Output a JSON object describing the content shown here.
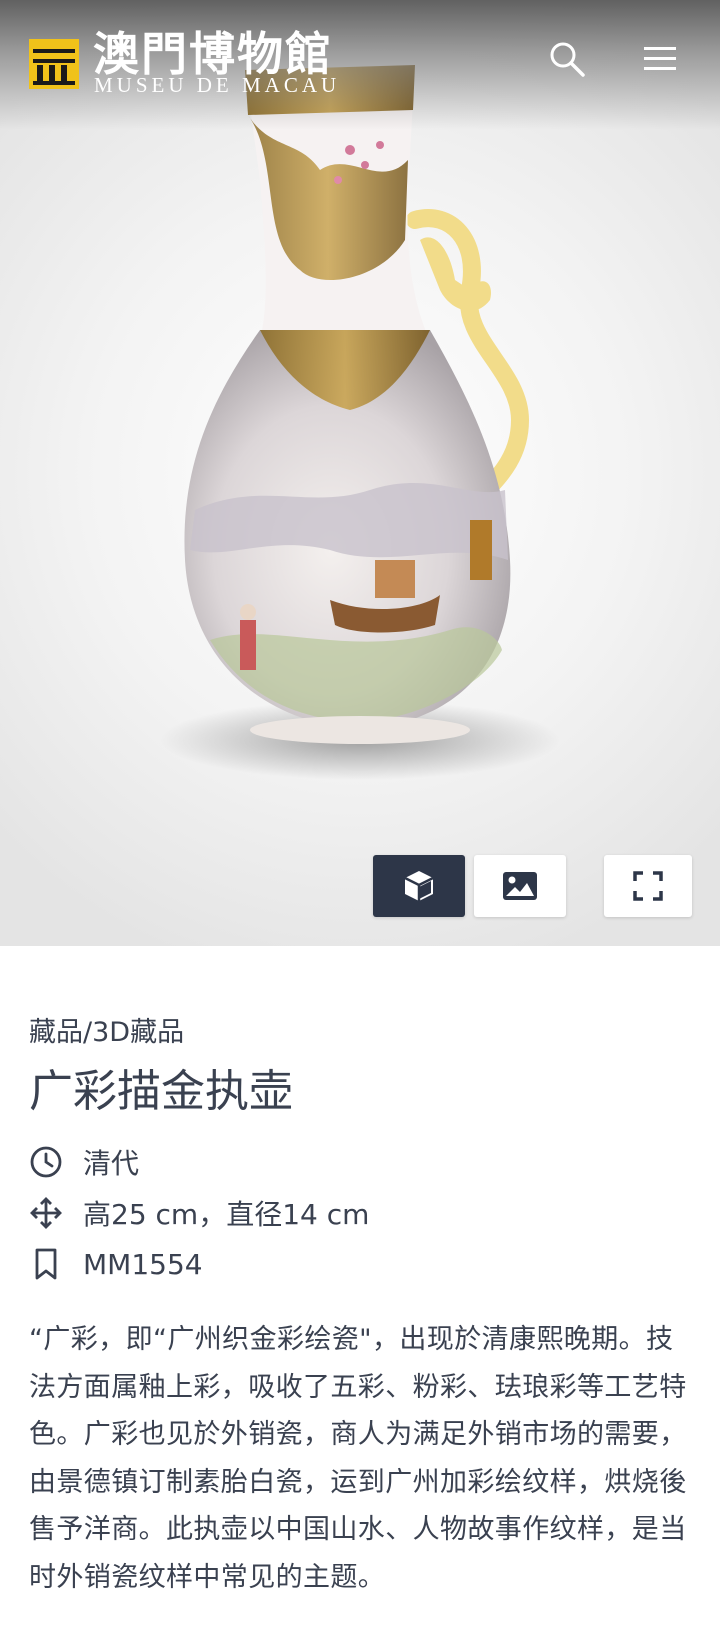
{
  "header": {
    "logo_title": "澳門博物館",
    "logo_subtitle": "MUSEU DE MACAU",
    "search_icon": "search-icon",
    "menu_icon": "menu-icon"
  },
  "viewer": {
    "controls": [
      {
        "icon": "cube-icon",
        "active": true
      },
      {
        "icon": "image-icon",
        "active": false
      },
      {
        "icon": "fullscreen-icon",
        "active": false
      }
    ],
    "accent_color": "#2d3648"
  },
  "item": {
    "breadcrumb": "藏品/3D藏品",
    "title": "广彩描金执壶",
    "period": "清代",
    "dimensions": "高25 cm，直径14 cm",
    "catalog_id": "MM1554",
    "description": "“广彩，即“广州织金彩绘瓷\"，出现於清康熙晚期。技法方面属釉上彩，吸收了五彩、粉彩、珐琅彩等工艺特色。广彩也见於外销瓷，商人为满足外销市场的需要，由景德镇订制素胎白瓷，运到广州加彩绘纹样，烘烧後售予洋商。此执壶以中国山水、人物故事作纹样，是当时外销瓷纹样中常见的主题。"
  }
}
